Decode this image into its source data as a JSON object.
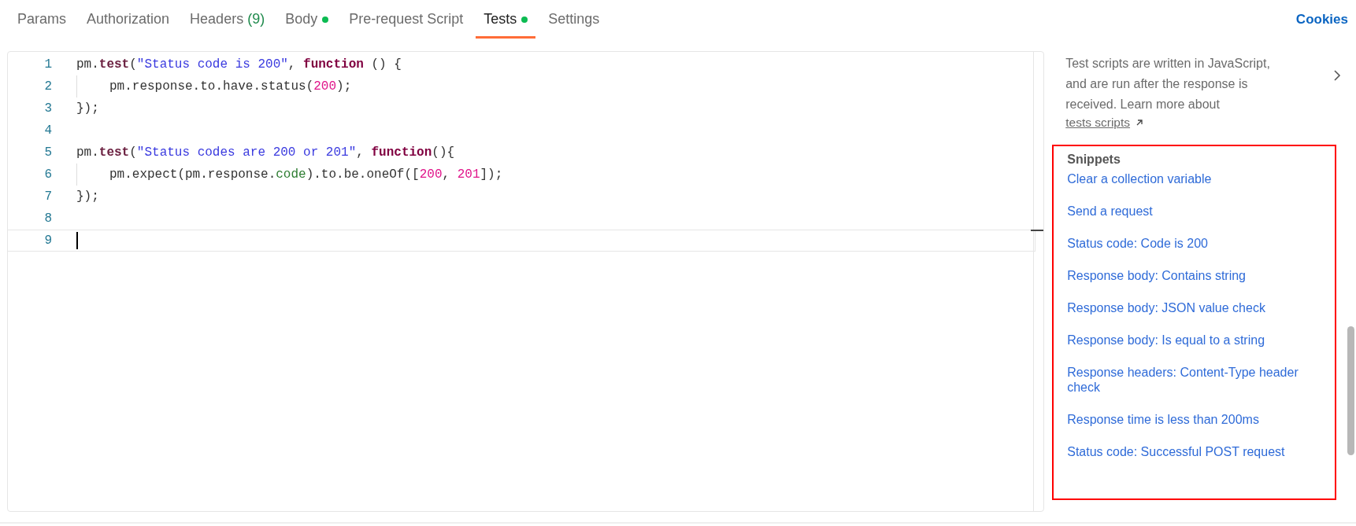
{
  "tabs": [
    {
      "label": "Params",
      "dot": false,
      "selected": false
    },
    {
      "label": "Authorization",
      "dot": false,
      "selected": false
    },
    {
      "label": "Headers",
      "count": "(9)",
      "dot": false,
      "selected": false
    },
    {
      "label": "Body",
      "dot": true,
      "selected": false
    },
    {
      "label": "Pre-request Script",
      "dot": false,
      "selected": false
    },
    {
      "label": "Tests",
      "dot": true,
      "selected": true
    },
    {
      "label": "Settings",
      "dot": false,
      "selected": false
    }
  ],
  "cookies_link": "Cookies",
  "editor": {
    "lines": [
      {
        "number": "1",
        "indent": false,
        "tokens": [
          {
            "kind": "plain",
            "text": "pm."
          },
          {
            "kind": "method",
            "text": "test"
          },
          {
            "kind": "plain",
            "text": "("
          },
          {
            "kind": "string",
            "text": "\"Status code is 200\""
          },
          {
            "kind": "plain",
            "text": ", "
          },
          {
            "kind": "keyword",
            "text": "function"
          },
          {
            "kind": "plain",
            "text": " () {"
          }
        ]
      },
      {
        "number": "2",
        "indent": true,
        "tokens": [
          {
            "kind": "plain",
            "text": "pm.response.to.have.status("
          },
          {
            "kind": "number",
            "text": "200"
          },
          {
            "kind": "plain",
            "text": ");"
          }
        ]
      },
      {
        "number": "3",
        "indent": false,
        "tokens": [
          {
            "kind": "plain",
            "text": "});"
          }
        ]
      },
      {
        "number": "4",
        "indent": false
      },
      {
        "number": "5",
        "indent": false,
        "tokens": [
          {
            "kind": "plain",
            "text": "pm."
          },
          {
            "kind": "method",
            "text": "test"
          },
          {
            "kind": "plain",
            "text": "("
          },
          {
            "kind": "string",
            "text": "\"Status codes are 200 or 201\""
          },
          {
            "kind": "plain",
            "text": ", "
          },
          {
            "kind": "keyword",
            "text": "function"
          },
          {
            "kind": "plain",
            "text": "(){"
          }
        ]
      },
      {
        "number": "6",
        "indent": true,
        "tokens": [
          {
            "kind": "plain",
            "text": "pm.expect(pm.response."
          },
          {
            "kind": "property",
            "text": "code"
          },
          {
            "kind": "plain",
            "text": ").to.be.oneOf(["
          },
          {
            "kind": "number",
            "text": "200"
          },
          {
            "kind": "plain",
            "text": ", "
          },
          {
            "kind": "number",
            "text": "201"
          },
          {
            "kind": "plain",
            "text": "]);"
          }
        ]
      },
      {
        "number": "7",
        "indent": false,
        "tokens": [
          {
            "kind": "plain",
            "text": "});"
          }
        ]
      },
      {
        "number": "8",
        "indent": false
      },
      {
        "number": "9",
        "indent": false,
        "current": true
      }
    ]
  },
  "sidebar": {
    "description": "Test scripts are written in JavaScript, and are run after the response is received. Learn more about",
    "link": "tests scripts",
    "snippets_title": "Snippets",
    "highlighted": true,
    "snippets": [
      "Clear a collection variable",
      "Send a request",
      "Status code: Code is 200",
      "Response body: Contains string",
      "Response body: JSON value check",
      "Response body: Is equal to a string",
      "Response headers: Content-Type header check",
      "Response time is less than 200ms",
      "Status code: Successful POST request"
    ]
  }
}
